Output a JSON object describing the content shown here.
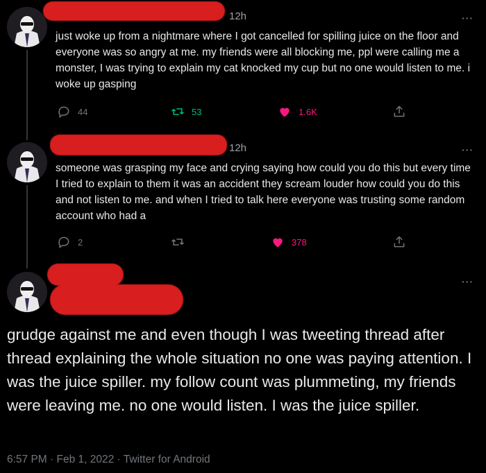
{
  "tweets": [
    {
      "time": "12h",
      "text": "just woke up from a nightmare where I got cancelled for spilling juice on the floor and everyone was so angry at me. my friends were all blocking me, ppl were calling me a monster, I was trying to explain my cat knocked my cup but no one would listen to me. i woke up gasping",
      "replies": "44",
      "retweets": "53",
      "likes": "1.6K"
    },
    {
      "time": "12h",
      "text": "someone was grasping my face and crying saying how could you do this but every time I tried to explain to them it was an accident they scream louder how could you do this and not listen to me. and when I tried to talk here everyone was trusting some random account who had a",
      "replies": "2",
      "retweets": "",
      "likes": "378"
    }
  ],
  "main_tweet": {
    "text": "grudge against me and even though I was tweeting thread after thread explaining the whole situation no one was paying attention. I was the juice spiller. my follow count was plummeting, my friends were leaving me. no one would listen. I was the juice spiller.",
    "meta": "6:57 PM · Feb 1, 2022 · Twitter for Android"
  },
  "more_label": "···",
  "colors": {
    "like": "#f91880",
    "retweet": "#00ba7c",
    "redaction": "#d81e1e"
  }
}
